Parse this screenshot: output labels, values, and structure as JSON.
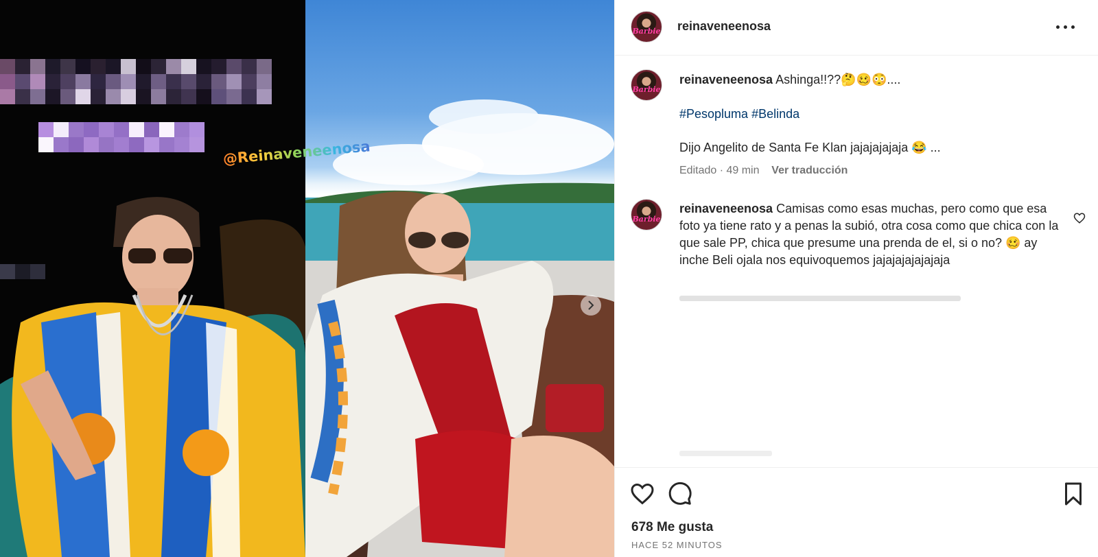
{
  "post": {
    "username": "reinaveneenosa",
    "avatar_badge": "Barbie",
    "watermark": "@Reinaveneenosa",
    "caption": {
      "username": "reinaveneenosa",
      "text": "Ashinga!!??🤔🥴😳....",
      "hashtags": [
        "#Pesopluma",
        "#Belinda"
      ],
      "line2": "Dijo Angelito de Santa Fe Klan jajajajajaja 😂 ...",
      "edited_label": "Editado · 49 min",
      "translate_label": "Ver traducción"
    },
    "comment": {
      "username": "reinaveneenosa",
      "text": "Camisas como esas muchas, pero como que esa foto ya tiene rato y a penas la subió, otra cosa como que chica con la que sale PP, chica que presume una prenda de el, si o no? 🥴 ay inche Beli ojala nos equivoquemos jajajajajajajaja"
    },
    "likes": "678 Me gusta",
    "posted_time": "HACE 52 MINUTOS"
  },
  "icons": {
    "more": "more-options-icon",
    "like": "heart-icon",
    "comment": "comment-bubble-icon",
    "save": "bookmark-icon",
    "next": "chevron-right-icon"
  },
  "colors": {
    "hashtag": "#00376b",
    "meta": "#737373",
    "text": "#262626",
    "divider": "#efefef"
  }
}
